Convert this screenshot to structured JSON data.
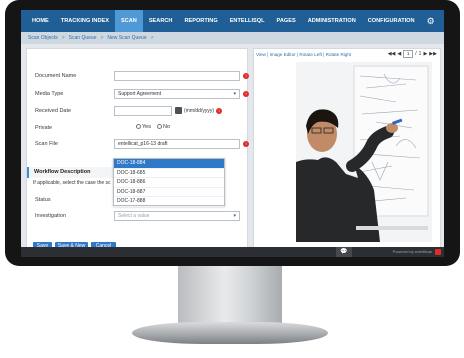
{
  "nav": {
    "items": [
      "HOME",
      "TRACKING INDEX",
      "SCAN",
      "SEARCH",
      "REPORTING",
      "ENTELLISQL",
      "PAGES",
      "ADMINISTRATION",
      "CONFIGURATION"
    ],
    "active": "SCAN",
    "settings_icon": "gear-icon"
  },
  "breadcrumb": [
    "Scan Objects",
    "Scan Queue",
    "New Scan Queue"
  ],
  "form": {
    "document_name": {
      "label": "Document Name",
      "value": ""
    },
    "media_type": {
      "label": "Media Type",
      "value": "Support Agreement"
    },
    "received_date": {
      "label": "Received Date",
      "value": "",
      "hint": "(mm/dd/yyyy)"
    },
    "private": {
      "label": "Private",
      "options": [
        "Yes",
        "No"
      ]
    },
    "scan_file": {
      "label": "Scan File",
      "value": "entellicat_p16-13 draft"
    },
    "workflow": {
      "heading": "Workflow Description",
      "text": "If applicable, select the case the sc"
    },
    "status": {
      "label": "Status"
    },
    "investigation": {
      "label": "Investigation",
      "placeholder": "Select a value"
    },
    "dropdown_options": [
      "DOC-18-884",
      "DOC-18-685",
      "DOC-18-886",
      "DOC-18-887",
      "DOC-17-888"
    ],
    "dropdown_selected": "DOC-18-884",
    "buttons": [
      "Save",
      "Save & New",
      "Cancel"
    ]
  },
  "viewer": {
    "links": "View | Image Editor | Rotate Left | Rotate Right",
    "page_current": "1",
    "page_sep": "/",
    "page_total": "1"
  },
  "footer": {
    "powered_by": "Powered by entellitrak"
  },
  "colors": {
    "nav": "#1f5f95",
    "nav_active": "#4f9ad6",
    "button": "#2f79c9",
    "required": "#e02b2b"
  }
}
